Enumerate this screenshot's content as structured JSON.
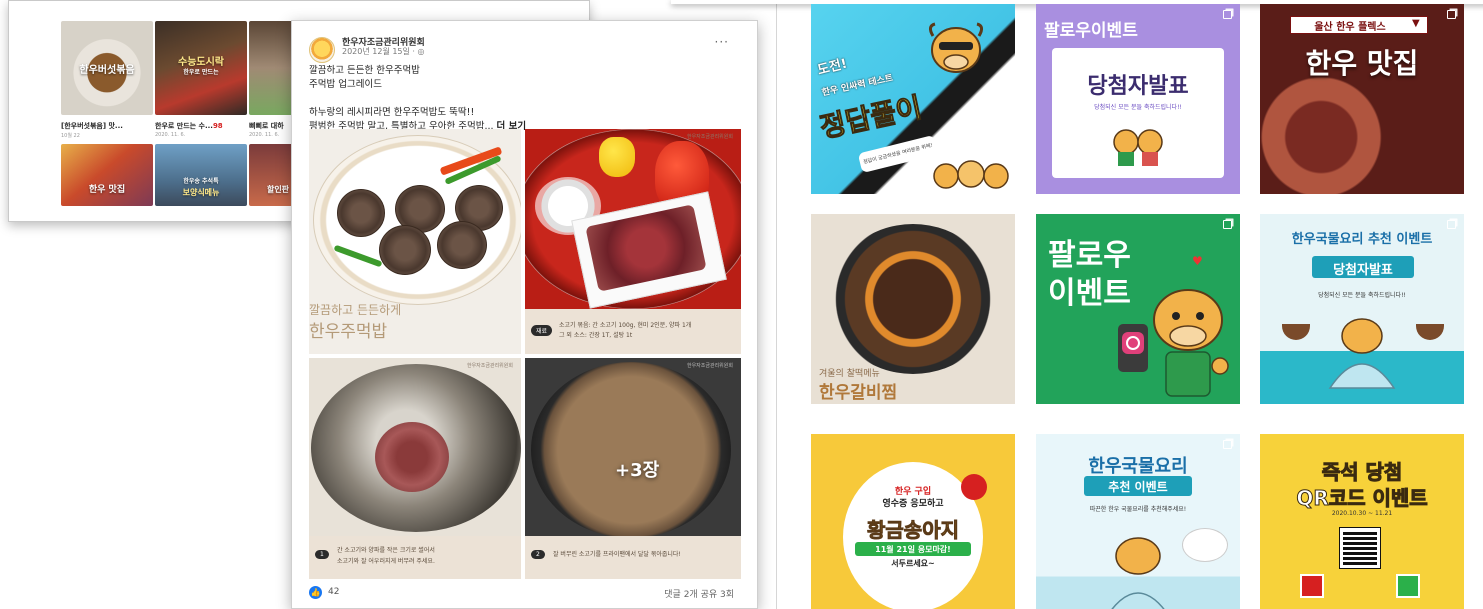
{
  "blog_panel": {
    "cards": [
      {
        "overlay": "한우버섯볶음",
        "title": "[한우버섯볶음] 맛...",
        "date": "10월 22"
      },
      {
        "overlay": "수능도시락",
        "sub": "한우로 만드는",
        "title": "한우로 만드는 수...",
        "badge": "98",
        "date": "2020. 11. 6."
      },
      {
        "title": "삐삐로 대하",
        "date": "2020. 11. 6."
      }
    ],
    "bottom_cards": [
      {
        "overlay": "한우 맛집"
      },
      {
        "overlay": "보양식메뉴",
        "sub": "한우송 추석특"
      },
      {
        "overlay": "할인판"
      }
    ]
  },
  "facebook_post": {
    "author": "한우자조금관리위원회",
    "date": "2020년 12월 15일 · ",
    "more_options": "···",
    "text_lines": [
      "깔끔하고 든든한 한우주먹밥",
      "주먹밥 업그레이드",
      "",
      "하누랑의 레시피라면 한우주먹밥도 뚝딱!!",
      "평범한 주먹밥 말고, 특별하고 우아한 주먹밥..."
    ],
    "see_more": "더 보기",
    "photos": [
      {
        "overlay_line1": "깔끔하고 든든하게",
        "overlay_line2": "한우주먹밥"
      },
      {
        "badge": "재료",
        "caption_line1": "소고기 볶음: 간 소고기 100g, 현미 2인분, 양파 1개",
        "caption_line2": "그 외 소스: 간장 1T, 설탕 1t"
      },
      {
        "badge": "1",
        "caption_line1": "간 소고기와 양파를 작은 크기로 썰어서",
        "caption_line2": "소고기와 잘 어우러지게 버무려 주세요."
      },
      {
        "badge": "2",
        "caption_line1": "잘 버무린 소고기를 프라이팬에서 달달 볶아줍니다!",
        "caption_line2": "",
        "more_label": "+3장"
      }
    ],
    "likes": "42",
    "comments_shares": "댓글 2개  공유 3회",
    "logo_text": "한우자조금관리위원회"
  },
  "instagram_grid": {
    "tiles": [
      {
        "big": "정답풀이",
        "top": "도전!",
        "sub": "한우 인싸력 테스트",
        "bubble": "정답이 궁금하셨을 여러분을 위해!"
      },
      {
        "top": "팔로우이벤트",
        "big": "당첨자발표",
        "sub": "당첨되신 모든 분들 축하드립니다!!"
      },
      {
        "top": "울산 한우 플렉스",
        "big": "한우 맛집"
      },
      {
        "top": "겨울의 찰떡메뉴",
        "big": "한우갈비찜"
      },
      {
        "big_line1": "팔로우",
        "big_line2": "이벤트"
      },
      {
        "top": "한우국물요리 추천 이벤트",
        "big": "당첨자발표",
        "sub": "당첨되신 모든 분들 축하드립니다!!"
      },
      {
        "line1": "한우 구입",
        "line2": "영수증 응모하고",
        "big": "황금송아지",
        "sub": "11월 21일 응모마감!",
        "sub2": "서두르세요~"
      },
      {
        "top": "한우국물요리",
        "big": "추천 이벤트",
        "sub": "따끈한 한우 국물요리를 추천해주세요!"
      },
      {
        "top": "즉석 당첨",
        "big": "QR코드 이벤트",
        "sub": "2020.10.30 ~ 11.21"
      }
    ]
  },
  "colors": {
    "facebook_blue": "#1877f2",
    "caption_beige": "#ece2d6",
    "ig_purple": "#a98fe0",
    "ig_green": "#22a35a",
    "ig_teal": "#2bb8c9",
    "ig_yellow": "#f7c93a"
  }
}
